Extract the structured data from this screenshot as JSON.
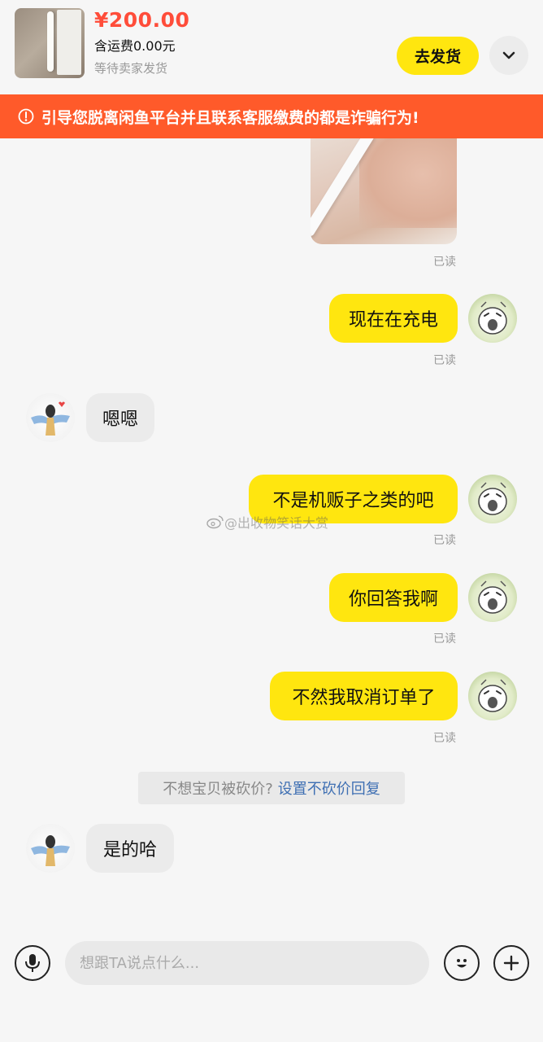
{
  "header": {
    "price": "¥200.00",
    "shipping": "含运费0.00元",
    "status": "等待卖家发货",
    "ship_button": "去发货"
  },
  "warning": {
    "text": "引导您脱离闲鱼平台并且联系客服缴费的都是诈骗行为!"
  },
  "messages": [
    {
      "side": "right",
      "type": "image",
      "read": "已读"
    },
    {
      "side": "right",
      "text": "现在在充电",
      "read": "已读"
    },
    {
      "side": "left",
      "text": "嗯嗯"
    },
    {
      "side": "right",
      "text": "不是机贩子之类的吧",
      "read": "已读"
    },
    {
      "side": "right",
      "text": "你回答我啊",
      "read": "已读"
    },
    {
      "side": "right",
      "text": "不然我取消订单了",
      "read": "已读"
    },
    {
      "side": "left",
      "text": "是的哈"
    }
  ],
  "system_tip": {
    "question": "不想宝贝被砍价?",
    "link": "设置不砍价回复"
  },
  "watermark": "@出收物笑话大赏",
  "input": {
    "placeholder": "想跟TA说点什么..."
  },
  "colors": {
    "accent_yellow": "#ffe60f",
    "price_red": "#ff4d3a",
    "warning_orange": "#ff5a2a",
    "link_blue": "#3e6fb3"
  },
  "icons": [
    "chevron-down-icon",
    "warning-circle-icon",
    "microphone-icon",
    "emoji-icon",
    "plus-icon"
  ]
}
